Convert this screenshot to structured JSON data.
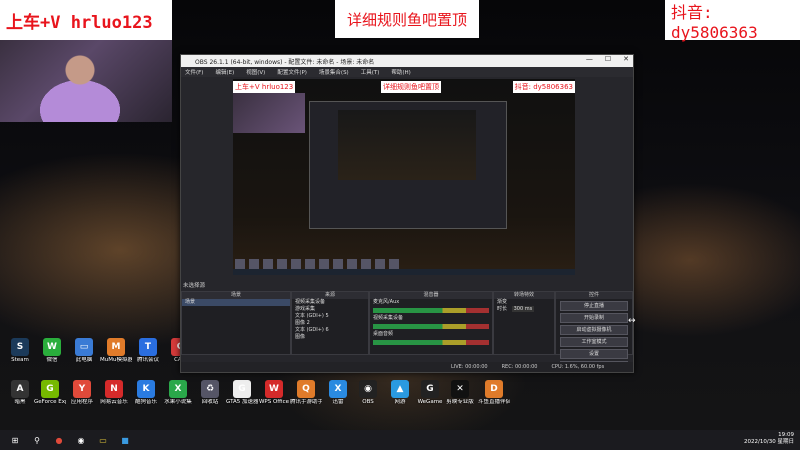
{
  "overlays": {
    "left_banner": "上车+V hrluo123",
    "center_banner": "详细规则鱼吧置顶",
    "right_banner": "抖音: dy5806363"
  },
  "obs": {
    "title": "OBS 26.1.1 (64-bit, windows) - 配置文件: 未命名 - 场景: 未命名",
    "menu": [
      "文件(F)",
      "编辑(E)",
      "视图(V)",
      "配置文件(P)",
      "场景集合(S)",
      "工具(T)",
      "帮助(H)"
    ],
    "preview": {
      "left_banner": "上车+V hrluo123",
      "center_banner": "详细规则鱼吧置顶",
      "right_banner": "抖音: dy5806363"
    },
    "status_label": "未选择源",
    "docks": {
      "scenes": {
        "header": "场景",
        "items": [
          "场景"
        ]
      },
      "sources": {
        "header": "来源",
        "items": [
          "视频采集设备",
          "游戏采集",
          "文本 (GDI+) 5",
          "图像 2",
          "文本 (GDI+) 6",
          "图像"
        ]
      },
      "mixer": {
        "header": "混音器",
        "tracks": [
          "麦克风/Aux",
          "视频采集设备",
          "桌面音频"
        ]
      },
      "transitions": {
        "header": "转场特效",
        "type": "渐变",
        "duration_label": "时长",
        "duration": "300 ms"
      },
      "controls": {
        "header": "控件",
        "buttons": [
          "停止直播",
          "开始录制",
          "启动虚拟摄像机",
          "工作室模式",
          "设置",
          "退出"
        ]
      }
    },
    "statusbar": {
      "live": "LIVE: 00:00:00",
      "rec": "REC: 00:00:00",
      "cpu": "CPU: 1.6%, 60.00 fps"
    }
  },
  "desktop_icons": [
    {
      "label": "Steam",
      "color": "#1b3a5a",
      "glyph": "S"
    },
    {
      "label": "微信",
      "color": "#2aae3c",
      "glyph": "W"
    },
    {
      "label": "此电脑",
      "color": "#3a7bd5",
      "glyph": "▭"
    },
    {
      "label": "MuMu模拟器",
      "color": "#e07b2a",
      "glyph": "M"
    },
    {
      "label": "腾讯会议",
      "color": "#2a6ee0",
      "glyph": "T"
    },
    {
      "label": "CAD",
      "color": "#d53a3a",
      "glyph": "C"
    },
    {
      "label": "暗黑",
      "color": "#333",
      "glyph": "A"
    },
    {
      "label": "GeForce Experience",
      "color": "#76b900",
      "glyph": "G"
    },
    {
      "label": "应用程序",
      "color": "#e04a3a",
      "glyph": "Y"
    },
    {
      "label": "网易云音乐",
      "color": "#d52a2a",
      "glyph": "N"
    },
    {
      "label": "酷狗音乐",
      "color": "#2a7be0",
      "glyph": "K"
    },
    {
      "label": "水果小说集",
      "color": "#2aa84a",
      "glyph": "X"
    },
    {
      "label": "回收站",
      "color": "#556",
      "glyph": "♻"
    },
    {
      "label": "GTA5 加速器",
      "color": "#eee",
      "glyph": "G"
    },
    {
      "label": "WPS Office",
      "color": "#d52a2a",
      "glyph": "W"
    },
    {
      "label": "腾讯手游助手",
      "color": "#e07b2a",
      "glyph": "Q"
    },
    {
      "label": "迅雷",
      "color": "#2a8ae0",
      "glyph": "X"
    },
    {
      "label": "OBS",
      "color": "#222",
      "glyph": "◉"
    },
    {
      "label": "网游",
      "color": "#2a9ae0",
      "glyph": "▲"
    },
    {
      "label": "WeGame",
      "color": "#222",
      "glyph": "G"
    },
    {
      "label": "剪映专业版",
      "color": "#111",
      "glyph": "✕"
    },
    {
      "label": "斗鱼直播伴侣",
      "color": "#e07b2a",
      "glyph": "D"
    }
  ],
  "taskbar": {
    "items": [
      "windows",
      "search",
      "browser",
      "obs",
      "explorer",
      "game"
    ],
    "time": "19:09",
    "date": "2022/10/30 星期日"
  }
}
